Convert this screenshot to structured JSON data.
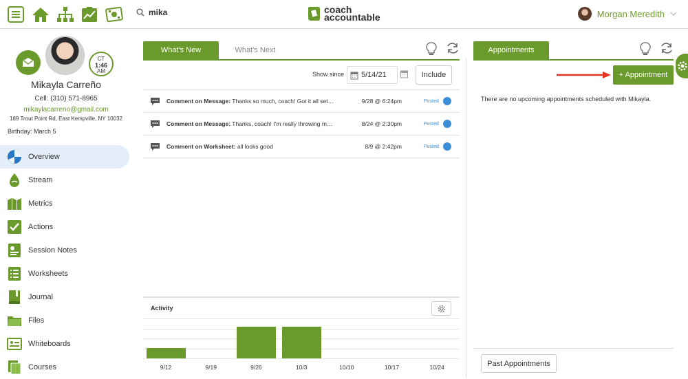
{
  "search": {
    "query": "mika"
  },
  "logo": {
    "line1": "coach",
    "line2": "accountable"
  },
  "user": {
    "name": "Morgan Meredith"
  },
  "client": {
    "name": "Mikayla Carreño",
    "cell": "Cell:  (310) 571-8965",
    "email": "mikaylacarreno@gmail.com",
    "address": "189 Trout Point Rd, East Kempville, NY 10032",
    "birthday": "Birthday: March 5",
    "clock": {
      "tz": "CT",
      "time": "1:46",
      "ampm": "AM"
    }
  },
  "nav": [
    {
      "label": "Overview",
      "icon": "overview-icon",
      "active": true
    },
    {
      "label": "Stream",
      "icon": "stream-icon"
    },
    {
      "label": "Metrics",
      "icon": "metrics-icon"
    },
    {
      "label": "Actions",
      "icon": "actions-icon"
    },
    {
      "label": "Session Notes",
      "icon": "session-notes-icon"
    },
    {
      "label": "Worksheets",
      "icon": "worksheets-icon"
    },
    {
      "label": "Journal",
      "icon": "journal-icon"
    },
    {
      "label": "Files",
      "icon": "files-icon"
    },
    {
      "label": "Whiteboards",
      "icon": "whiteboards-icon"
    },
    {
      "label": "Courses",
      "icon": "courses-icon"
    }
  ],
  "main": {
    "tabs": [
      "What's New",
      "What's Next"
    ],
    "show_since_label": "Show since",
    "show_since_date": "5/14/21",
    "include_label": "Include",
    "feed": [
      {
        "type": "Comment on Message:",
        "text": "Thanks so much, coach! Got it all set…",
        "date": "9/28 @ 6:24pm",
        "status": "Posted"
      },
      {
        "type": "Comment on Message:",
        "text": "Thanks, coach! I'm really throwing m…",
        "date": "8/24 @ 2:30pm",
        "status": "Posted"
      },
      {
        "type": "Comment on Worksheet:",
        "text": "all looks good",
        "date": "8/9 @ 2:42pm",
        "status": "Posted"
      }
    ],
    "activity_title": "Activity"
  },
  "chart_data": {
    "type": "bar",
    "title": "Activity",
    "categories": [
      "9/12",
      "9/19",
      "9/26",
      "10/3",
      "10/10",
      "10/17",
      "10/24"
    ],
    "values": [
      1,
      0,
      3,
      3,
      0,
      0,
      0
    ],
    "ylim": [
      0,
      4
    ],
    "grid": true,
    "color": "#6b9a2c"
  },
  "appointments": {
    "tab_label": "Appointments",
    "add_label": "+ Appointment",
    "empty_text": "There are no upcoming appointments scheduled with Mikayla.",
    "past_label": "Past Appointments"
  },
  "colors": {
    "brand": "#6b9a2c",
    "status_blue": "#3a8ed6",
    "arrow": "#e53423"
  }
}
